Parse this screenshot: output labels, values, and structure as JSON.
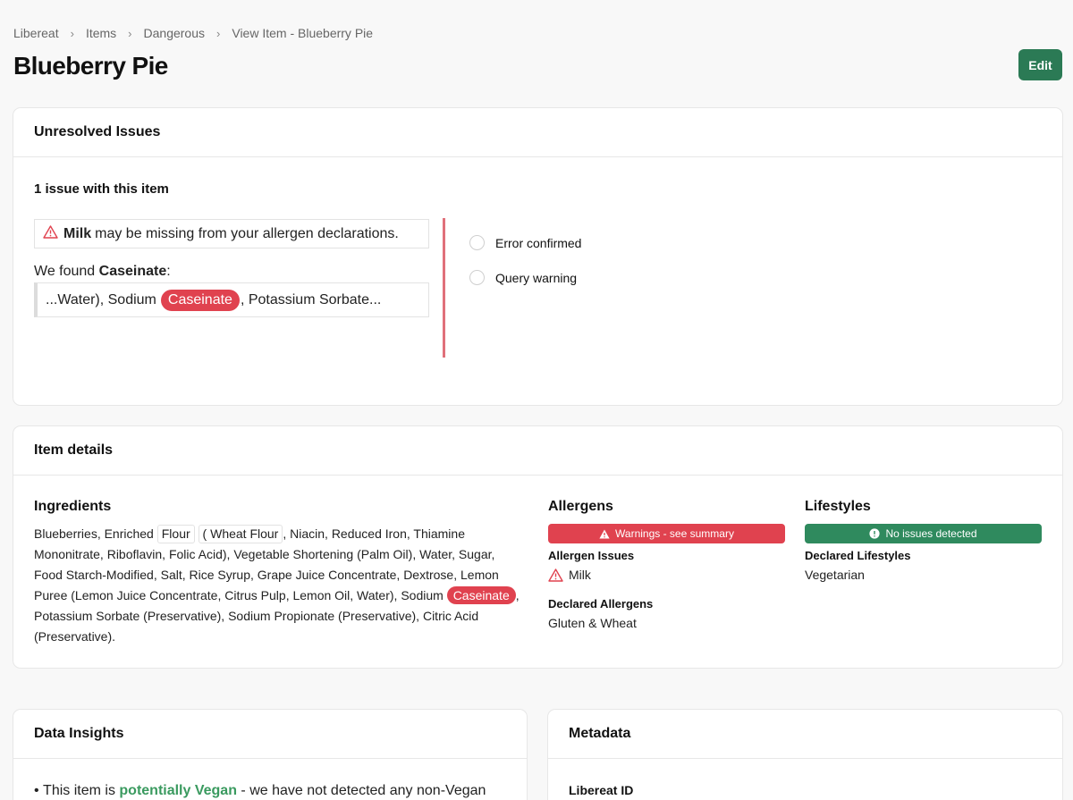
{
  "breadcrumb": [
    "Libereat",
    "Items",
    "Dangerous",
    "View Item - Blueberry Pie"
  ],
  "page_title": "Blueberry Pie",
  "edit_label": "Edit",
  "issues": {
    "title": "Unresolved Issues",
    "count_text": "1 issue with this item",
    "allergen": "Milk",
    "warning_text": "may be missing from your allergen declarations.",
    "found_prefix": "We found ",
    "found_term": "Caseinate",
    "found_suffix": ":",
    "snippet_before": "...Water), Sodium",
    "snippet_highlight": "Caseinate",
    "snippet_after": ", Potassium Sorbate...",
    "options": [
      "Error confirmed",
      "Query warning"
    ]
  },
  "details": {
    "title": "Item details",
    "ingredients_title": "Ingredients",
    "ingredients": {
      "part1": "Blueberries, Enriched ",
      "flour": "Flour",
      "part2": " ",
      "wheat_flour": "( Wheat Flour",
      "part3": ", Niacin, Reduced Iron, Thiamine Mononitrate, Riboflavin, Folic Acid), Vegetable Shortening (Palm Oil), Water, Sugar, Food Starch-Modified, Salt, Rice Syrup, Grape Juice Concentrate, Dextrose, Lemon Puree (Lemon Juice Concentrate, Citrus Pulp, Lemon Oil, Water), Sodium ",
      "caseinate": "Caseinate",
      "part4": ", Potassium Sorbate (Preservative), Sodium Propionate (Preservative), Citric Acid (Preservative)."
    },
    "allergens_title": "Allergens",
    "allergens_bar": "Warnings - see summary",
    "allergen_issues_label": "Allergen Issues",
    "allergen_issue": "Milk",
    "declared_allergens_label": "Declared Allergens",
    "declared_allergens": "Gluten & Wheat",
    "lifestyles_title": "Lifestyles",
    "lifestyles_bar": "No issues detected",
    "declared_lifestyles_label": "Declared Lifestyles",
    "declared_lifestyles": "Vegetarian"
  },
  "insights": {
    "title": "Data Insights",
    "line_prefix": "This item is ",
    "line_highlight": "potentially Vegan",
    "line_suffix": " - we have not detected any non-Vegan"
  },
  "metadata": {
    "title": "Metadata",
    "id_label": "Libereat ID"
  },
  "colors": {
    "accent_green": "#2b7a55",
    "danger_red": "#e0424f",
    "success_green": "#2f8a5e"
  }
}
